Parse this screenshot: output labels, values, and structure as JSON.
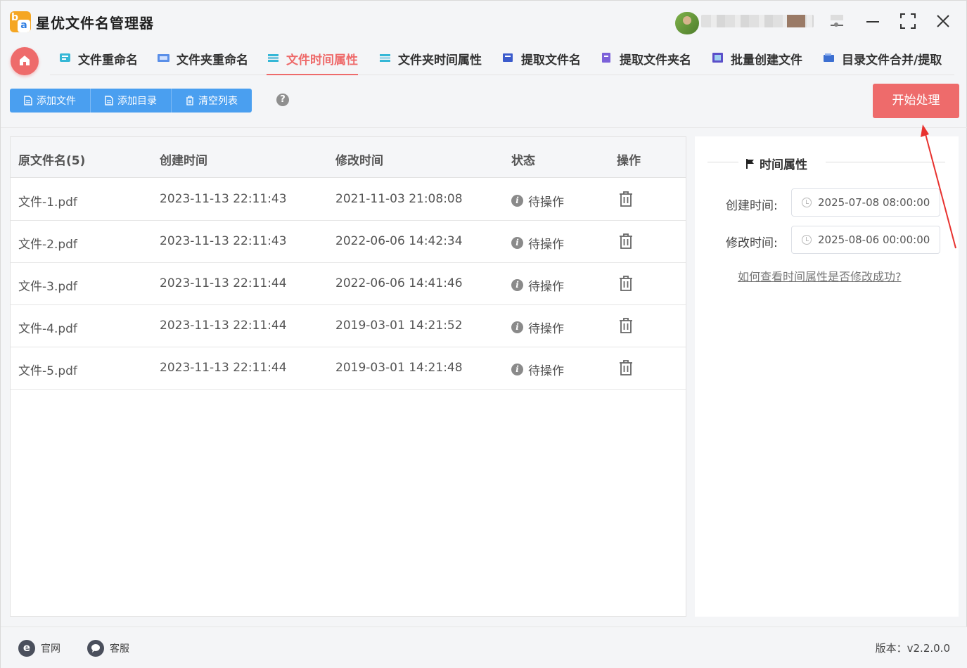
{
  "app": {
    "title": "星优文件名管理器",
    "logo_letters": [
      "b",
      "a"
    ]
  },
  "nav": {
    "tabs": [
      {
        "label": "文件重命名",
        "icon": "file-rename-icon",
        "active": false
      },
      {
        "label": "文件夹重命名",
        "icon": "folder-rename-icon",
        "active": false
      },
      {
        "label": "文件时间属性",
        "icon": "file-time-icon",
        "active": true
      },
      {
        "label": "文件夹时间属性",
        "icon": "folder-time-icon",
        "active": false
      },
      {
        "label": "提取文件名",
        "icon": "extract-filename-icon",
        "active": false
      },
      {
        "label": "提取文件夹名",
        "icon": "extract-foldername-icon",
        "active": false
      },
      {
        "label": "批量创建文件",
        "icon": "batch-create-icon",
        "active": false
      },
      {
        "label": "目录文件合并/提取",
        "icon": "merge-extract-icon",
        "active": false
      }
    ]
  },
  "toolbar": {
    "add_file": "添加文件",
    "add_dir": "添加目录",
    "clear_list": "清空列表",
    "help": "?",
    "start": "开始处理"
  },
  "table": {
    "headers": {
      "name": "原文件名(5)",
      "created": "创建时间",
      "modified": "修改时间",
      "status": "状态",
      "action": "操作"
    },
    "rows": [
      {
        "name": "文件-1.pdf",
        "created": "2023-11-13 22:11:43",
        "modified": "2021-11-03 21:08:08",
        "status": "待操作"
      },
      {
        "name": "文件-2.pdf",
        "created": "2023-11-13 22:11:43",
        "modified": "2022-06-06 14:42:34",
        "status": "待操作"
      },
      {
        "name": "文件-3.pdf",
        "created": "2023-11-13 22:11:44",
        "modified": "2022-06-06 14:41:46",
        "status": "待操作"
      },
      {
        "name": "文件-4.pdf",
        "created": "2023-11-13 22:11:44",
        "modified": "2019-03-01 14:21:52",
        "status": "待操作"
      },
      {
        "name": "文件-5.pdf",
        "created": "2023-11-13 22:11:44",
        "modified": "2019-03-01 14:21:48",
        "status": "待操作"
      }
    ]
  },
  "side": {
    "title": "时间属性",
    "created_label": "创建时间:",
    "created_value": "2025-07-08 08:00:00",
    "modified_label": "修改时间:",
    "modified_value": "2025-08-06 00:00:00",
    "help_link": "如何查看时间属性是否修改成功?"
  },
  "footer": {
    "website": "官网",
    "website_icon_letter": "e",
    "support": "客服",
    "version": "版本：v2.2.0.0"
  },
  "colors": {
    "accent": "#ee6b6b",
    "toolbar_blue": "#4a9ff0"
  }
}
